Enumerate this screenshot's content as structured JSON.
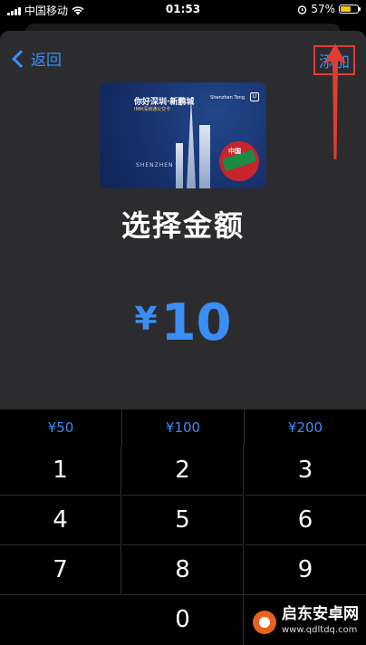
{
  "status_bar": {
    "carrier": "中国移动",
    "time": "01:53",
    "battery_percent": "57%",
    "battery_level": 0.57,
    "icons": [
      "signal-icon",
      "wifi-icon",
      "alarm-icon",
      "battery-icon"
    ]
  },
  "nav": {
    "back_label": "返回",
    "add_label": "添加"
  },
  "card": {
    "title": "你好深圳·新鹏城",
    "subtitle": "IMM深圳通公交卡",
    "brand": "Shenzhen Tong",
    "city_text": "SHENZHEN",
    "badge_text": "中国",
    "square_logo": "U"
  },
  "heading": "选择金额",
  "amount": {
    "currency": "¥",
    "value": "10"
  },
  "presets": [
    "¥50",
    "¥100",
    "¥200"
  ],
  "keys": [
    "1",
    "2",
    "3",
    "4",
    "5",
    "6",
    "7",
    "8",
    "9",
    "0"
  ],
  "watermark": {
    "name": "启东安卓网",
    "url": "www.qdltdq.com"
  },
  "colors": {
    "accent": "#3a8ef6",
    "highlight_red": "#e23b35",
    "sheet": "#2c2c2e",
    "background": "#000000"
  }
}
